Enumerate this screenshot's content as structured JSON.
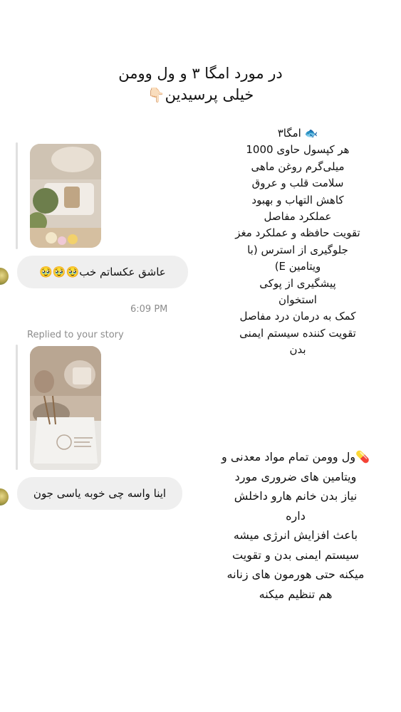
{
  "header": {
    "line1": "در مورد امگا ۳ و ول وومن",
    "line2": "خیلی پرسیدین",
    "line2_emoji": "👇🏻"
  },
  "omega": {
    "lines": [
      "🐟 امگا۳",
      "هر کپسول حاوی 1000",
      "میلی‌گرم روغن ماهی",
      "سلامت قلب و عروق",
      "کاهش التهاب و بهبود",
      "عملکرد مفاصل",
      "تقویت حافظه و عملکرد مغز",
      "جلوگیری از استرس  (با",
      "ویتامین E)",
      "پیشگیری از پوکی",
      "استخوان",
      "کمک به درمان درد مفاصل",
      "تقویت کننده سیستم ایمنی",
      "بدن"
    ]
  },
  "wellwoman": {
    "lines": [
      "💊ول وومن تمام مواد معدنی و",
      "ویتامین های  ضروری مورد",
      "نیاز بدن خانم هارو داخلش",
      "داره",
      "باعث افزایش انرژی میشه",
      "سیستم ایمنی بدن و تقویت",
      "میکنه حتی هورمون های زنانه",
      "هم تنظیم میکنه"
    ]
  },
  "chat": {
    "message1": "عاشق عکساتم خب🥹🥹🥹",
    "timestamp": "6:09 PM",
    "replied_label": "Replied to your story",
    "message2": "اینا واسه چی خوبه یاسی جون"
  }
}
